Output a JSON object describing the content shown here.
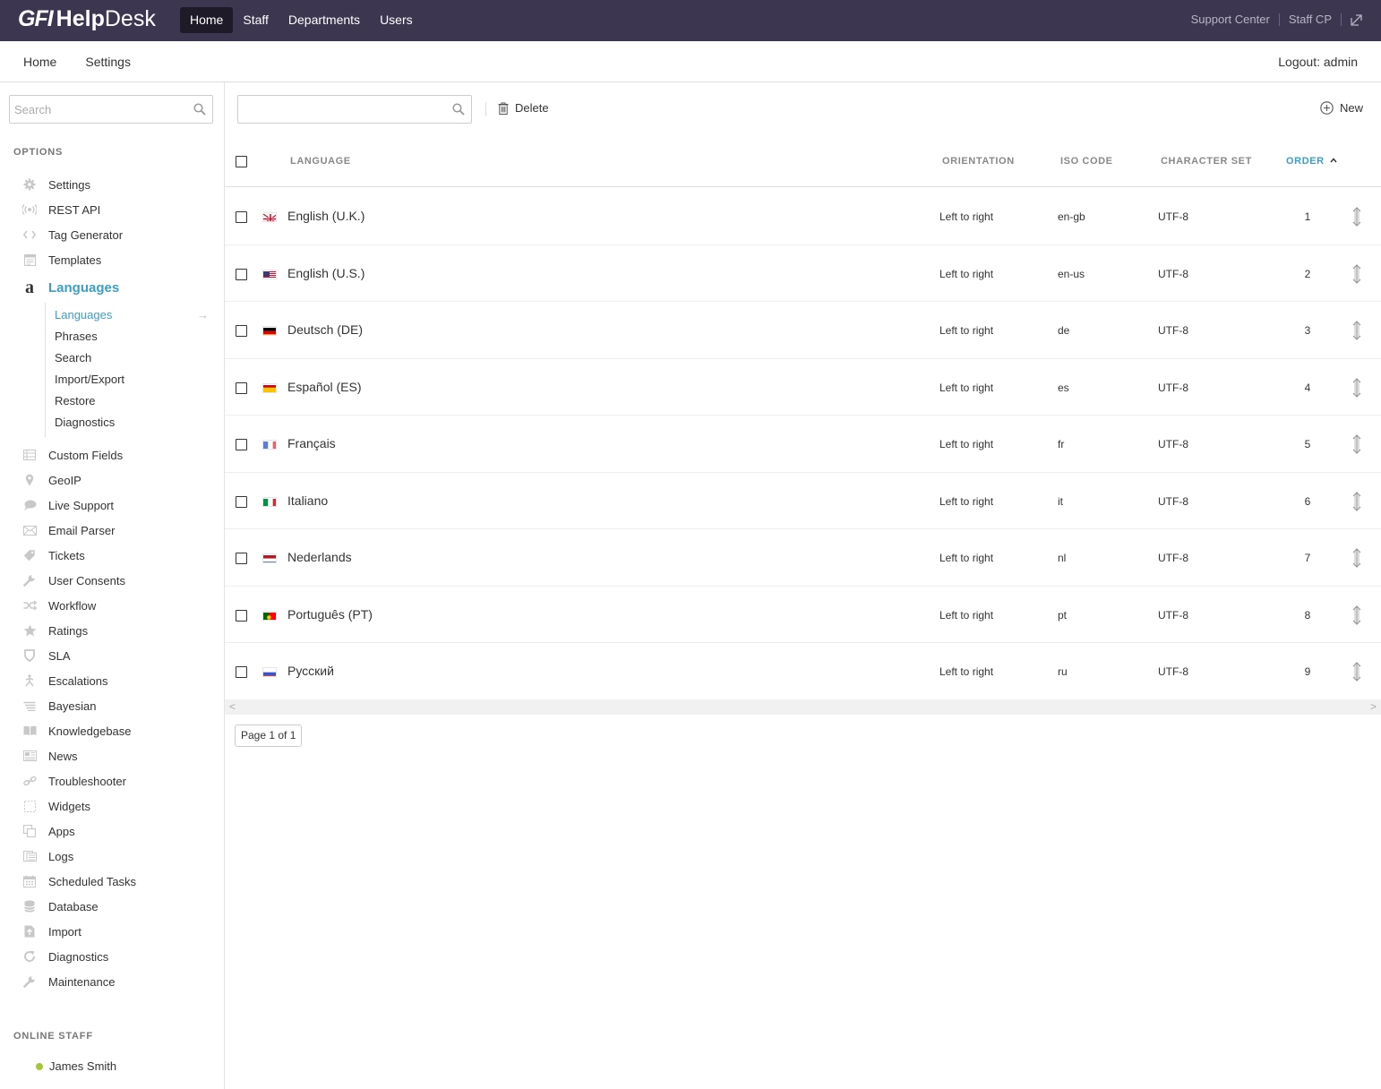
{
  "app": {
    "logo_gfi": "GFI",
    "logo_help": "Help",
    "logo_desk": "Desk",
    "accent_color": "#3d9ec4",
    "topbar_color": "#3d3650"
  },
  "topnav": {
    "items": [
      "Home",
      "Staff",
      "Departments",
      "Users"
    ],
    "active": "Home",
    "support_center": "Support Center",
    "staff_cp": "Staff CP",
    "external_icon": "external-link-icon"
  },
  "subnav": {
    "items": [
      "Home",
      "Settings"
    ],
    "logout": "Logout: admin"
  },
  "sidebar": {
    "search_placeholder": "Search",
    "options_label": "OPTIONS",
    "items_top": [
      {
        "label": "Settings",
        "icon": "gear-icon"
      },
      {
        "label": "REST API",
        "icon": "broadcast-icon"
      },
      {
        "label": "Tag Generator",
        "icon": "code-icon"
      },
      {
        "label": "Templates",
        "icon": "template-icon"
      }
    ],
    "active_item": {
      "label": "Languages",
      "icon_glyph": "a",
      "icon": "language-icon"
    },
    "subitems": [
      "Languages",
      "Phrases",
      "Search",
      "Import/Export",
      "Restore",
      "Diagnostics"
    ],
    "subitem_active": "Languages",
    "subitem_arrow": "→",
    "items_bottom": [
      {
        "label": "Custom Fields",
        "icon": "list-icon"
      },
      {
        "label": "GeoIP",
        "icon": "map-pin-icon"
      },
      {
        "label": "Live Support",
        "icon": "chat-icon"
      },
      {
        "label": "Email Parser",
        "icon": "envelope-icon"
      },
      {
        "label": "Tickets",
        "icon": "tag-icon"
      },
      {
        "label": "User Consents",
        "icon": "wrench-icon"
      },
      {
        "label": "Workflow",
        "icon": "shuffle-icon"
      },
      {
        "label": "Ratings",
        "icon": "star-icon"
      },
      {
        "label": "SLA",
        "icon": "shield-icon"
      },
      {
        "label": "Escalations",
        "icon": "escalation-icon"
      },
      {
        "label": "Bayesian",
        "icon": "lines-icon"
      },
      {
        "label": "Knowledgebase",
        "icon": "book-icon"
      },
      {
        "label": "News",
        "icon": "newspaper-icon"
      },
      {
        "label": "Troubleshooter",
        "icon": "link-icon"
      },
      {
        "label": "Widgets",
        "icon": "widget-icon"
      },
      {
        "label": "Apps",
        "icon": "apps-icon"
      },
      {
        "label": "Logs",
        "icon": "logs-icon"
      },
      {
        "label": "Scheduled Tasks",
        "icon": "calendar-icon"
      },
      {
        "label": "Database",
        "icon": "database-icon"
      },
      {
        "label": "Import",
        "icon": "import-icon"
      },
      {
        "label": "Diagnostics",
        "icon": "refresh-icon"
      },
      {
        "label": "Maintenance",
        "icon": "wrench-icon"
      }
    ],
    "online_staff_label": "ONLINE STAFF",
    "online_staff": [
      {
        "name": "James Smith",
        "status_color": "#a4c639"
      }
    ]
  },
  "toolbar": {
    "search_placeholder": "",
    "delete_label": "Delete",
    "new_label": "New"
  },
  "table": {
    "headers": {
      "language": "LANGUAGE",
      "orientation": "ORIENTATION",
      "iso_code": "ISO CODE",
      "character_set": "CHARACTER SET",
      "order": "ORDER"
    },
    "sorted_by": "order",
    "sort_direction": "ascending",
    "rows": [
      {
        "flag": "gb",
        "language": "English (U.K.)",
        "orientation": "Left to right",
        "iso": "en-gb",
        "charset": "UTF-8",
        "order": "1"
      },
      {
        "flag": "us",
        "language": "English (U.S.)",
        "orientation": "Left to right",
        "iso": "en-us",
        "charset": "UTF-8",
        "order": "2"
      },
      {
        "flag": "de",
        "language": "Deutsch (DE)",
        "orientation": "Left to right",
        "iso": "de",
        "charset": "UTF-8",
        "order": "3"
      },
      {
        "flag": "es",
        "language": "Español (ES)",
        "orientation": "Left to right",
        "iso": "es",
        "charset": "UTF-8",
        "order": "4"
      },
      {
        "flag": "fr",
        "language": "Français",
        "orientation": "Left to right",
        "iso": "fr",
        "charset": "UTF-8",
        "order": "5"
      },
      {
        "flag": "it",
        "language": "Italiano",
        "orientation": "Left to right",
        "iso": "it",
        "charset": "UTF-8",
        "order": "6"
      },
      {
        "flag": "nl",
        "language": "Nederlands",
        "orientation": "Left to right",
        "iso": "nl",
        "charset": "UTF-8",
        "order": "7"
      },
      {
        "flag": "pt",
        "language": "Português (PT)",
        "orientation": "Left to right",
        "iso": "pt",
        "charset": "UTF-8",
        "order": "8"
      },
      {
        "flag": "ru",
        "language": "Русский",
        "orientation": "Left to right",
        "iso": "ru",
        "charset": "UTF-8",
        "order": "9"
      }
    ],
    "pager": "Page 1 of 1"
  }
}
